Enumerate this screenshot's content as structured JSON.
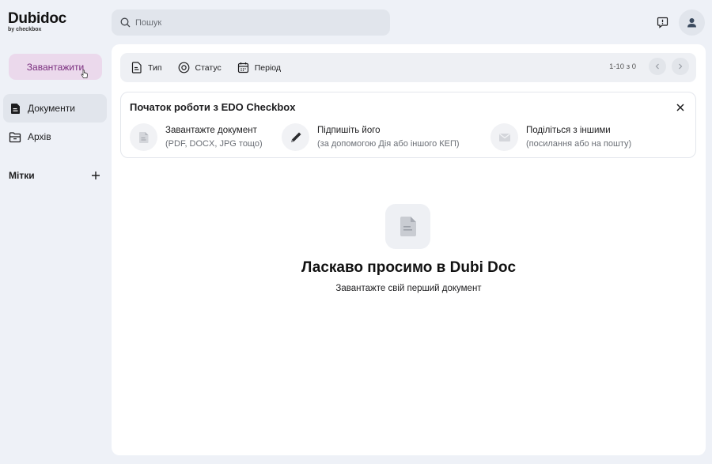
{
  "brand": {
    "name": "Dubidoc",
    "sub": "by checkbox"
  },
  "sidebar": {
    "upload_label": "Завантажити",
    "items": [
      {
        "label": "Документи",
        "icon": "document-icon",
        "active": true
      },
      {
        "label": "Архів",
        "icon": "archive-folder-icon",
        "active": false
      }
    ],
    "tags_label": "Мітки"
  },
  "search": {
    "placeholder": "Пошук"
  },
  "filters": {
    "items": [
      {
        "label": "Тип",
        "icon": "file-type-icon"
      },
      {
        "label": "Статус",
        "icon": "status-circle-icon"
      },
      {
        "label": "Період",
        "icon": "calendar-icon"
      }
    ],
    "pager_text": "1-10 з 0"
  },
  "onboarding": {
    "title": "Початок роботи з EDO Checkbox",
    "steps": [
      {
        "title": "Завантажте документ",
        "subtitle": "(PDF, DOCX, JPG тощо)",
        "icon": "document-icon"
      },
      {
        "title": "Підпишіть його",
        "subtitle": "(за допомогою Дія або іншого КЕП)",
        "icon": "pen-icon"
      },
      {
        "title": "Поділіться з іншими",
        "subtitle": "(посилання або на пошту)",
        "icon": "envelope-icon"
      }
    ]
  },
  "empty_state": {
    "title": "Ласкаво просимо в Dubi Doc",
    "subtitle": "Завантажте свій перший документ"
  },
  "colors": {
    "accent": "#7a2e7e",
    "accent_bg": "#ebd9ec",
    "page_bg": "#eef1f7"
  }
}
